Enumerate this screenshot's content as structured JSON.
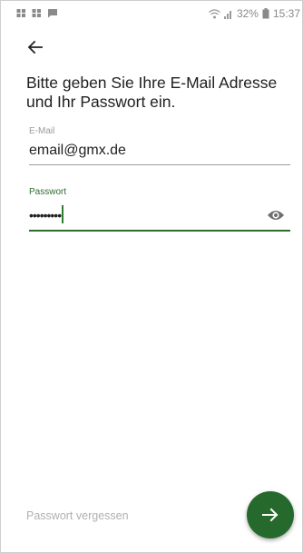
{
  "status_bar": {
    "battery_percent": "32%",
    "time": "15:37",
    "icons": [
      "app-icon",
      "app-icon",
      "message-icon",
      "wifi-icon",
      "signal-icon",
      "battery-icon"
    ]
  },
  "header": {
    "back_icon": "arrow-left-icon"
  },
  "heading": "Bitte geben Sie Ihre E-Mail Adresse und Ihr Passwort ein.",
  "email": {
    "label": "E-Mail",
    "value": "email@gmx.de"
  },
  "password": {
    "label": "Passwort",
    "value": "•••••••••",
    "visibility_icon": "eye-icon"
  },
  "forgot_password": "Passwort vergessen",
  "submit_icon": "arrow-right-icon",
  "colors": {
    "accent": "#256a2c",
    "focused_label": "#2e6b2e",
    "muted_text": "#b0b0b0"
  }
}
